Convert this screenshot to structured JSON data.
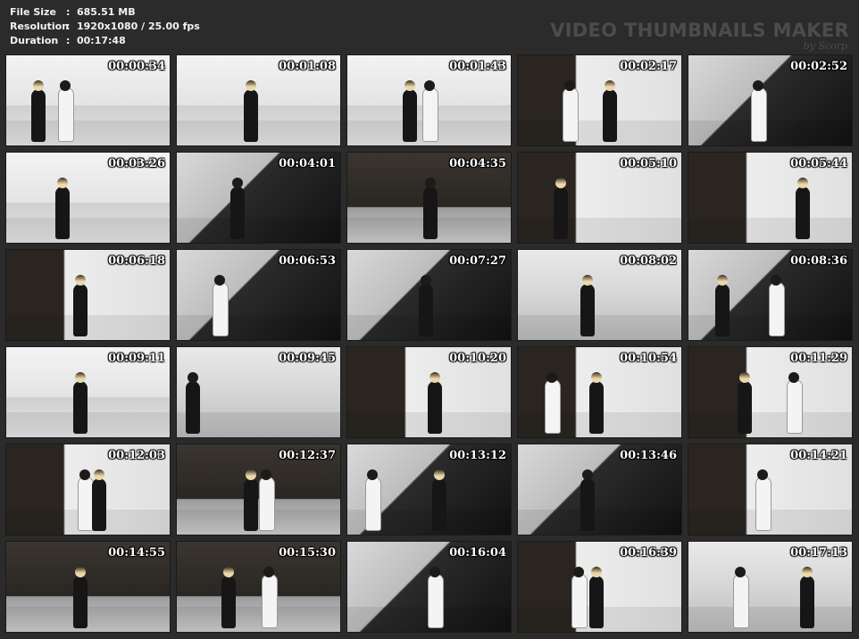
{
  "meta": {
    "file_size_label": "File Size",
    "file_size": "685.51 MB",
    "resolution_label": "Resolution",
    "resolution": "1920x1080 / 25.00 fps",
    "duration_label": "Duration",
    "duration": "00:17:48",
    "separator": ":"
  },
  "watermark": {
    "title": "VIDEO THUMBNAILS MAKER",
    "byline": "by Scorp"
  },
  "thumbnails": [
    {
      "time": "00:00:34",
      "scene": "studio"
    },
    {
      "time": "00:01:08",
      "scene": "studio"
    },
    {
      "time": "00:01:43",
      "scene": "studio"
    },
    {
      "time": "00:02:17",
      "scene": "mixed"
    },
    {
      "time": "00:02:52",
      "scene": "close"
    },
    {
      "time": "00:03:26",
      "scene": "studio"
    },
    {
      "time": "00:04:01",
      "scene": "close"
    },
    {
      "time": "00:04:35",
      "scene": "dark"
    },
    {
      "time": "00:05:10",
      "scene": "mixed"
    },
    {
      "time": "00:05:44",
      "scene": "mixed"
    },
    {
      "time": "00:06:18",
      "scene": "mixed"
    },
    {
      "time": "00:06:53",
      "scene": "close"
    },
    {
      "time": "00:07:27",
      "scene": "close"
    },
    {
      "time": "00:08:02",
      "scene": "floor"
    },
    {
      "time": "00:08:36",
      "scene": "close"
    },
    {
      "time": "00:09:11",
      "scene": "studio"
    },
    {
      "time": "00:09:45",
      "scene": "floor"
    },
    {
      "time": "00:10:20",
      "scene": "mixed"
    },
    {
      "time": "00:10:54",
      "scene": "mixed"
    },
    {
      "time": "00:11:29",
      "scene": "mixed"
    },
    {
      "time": "00:12:03",
      "scene": "mixed"
    },
    {
      "time": "00:12:37",
      "scene": "dark"
    },
    {
      "time": "00:13:12",
      "scene": "close"
    },
    {
      "time": "00:13:46",
      "scene": "close"
    },
    {
      "time": "00:14:21",
      "scene": "mixed"
    },
    {
      "time": "00:14:55",
      "scene": "dark"
    },
    {
      "time": "00:15:30",
      "scene": "dark"
    },
    {
      "time": "00:16:04",
      "scene": "close"
    },
    {
      "time": "00:16:39",
      "scene": "mixed"
    },
    {
      "time": "00:17:13",
      "scene": "floor"
    }
  ]
}
